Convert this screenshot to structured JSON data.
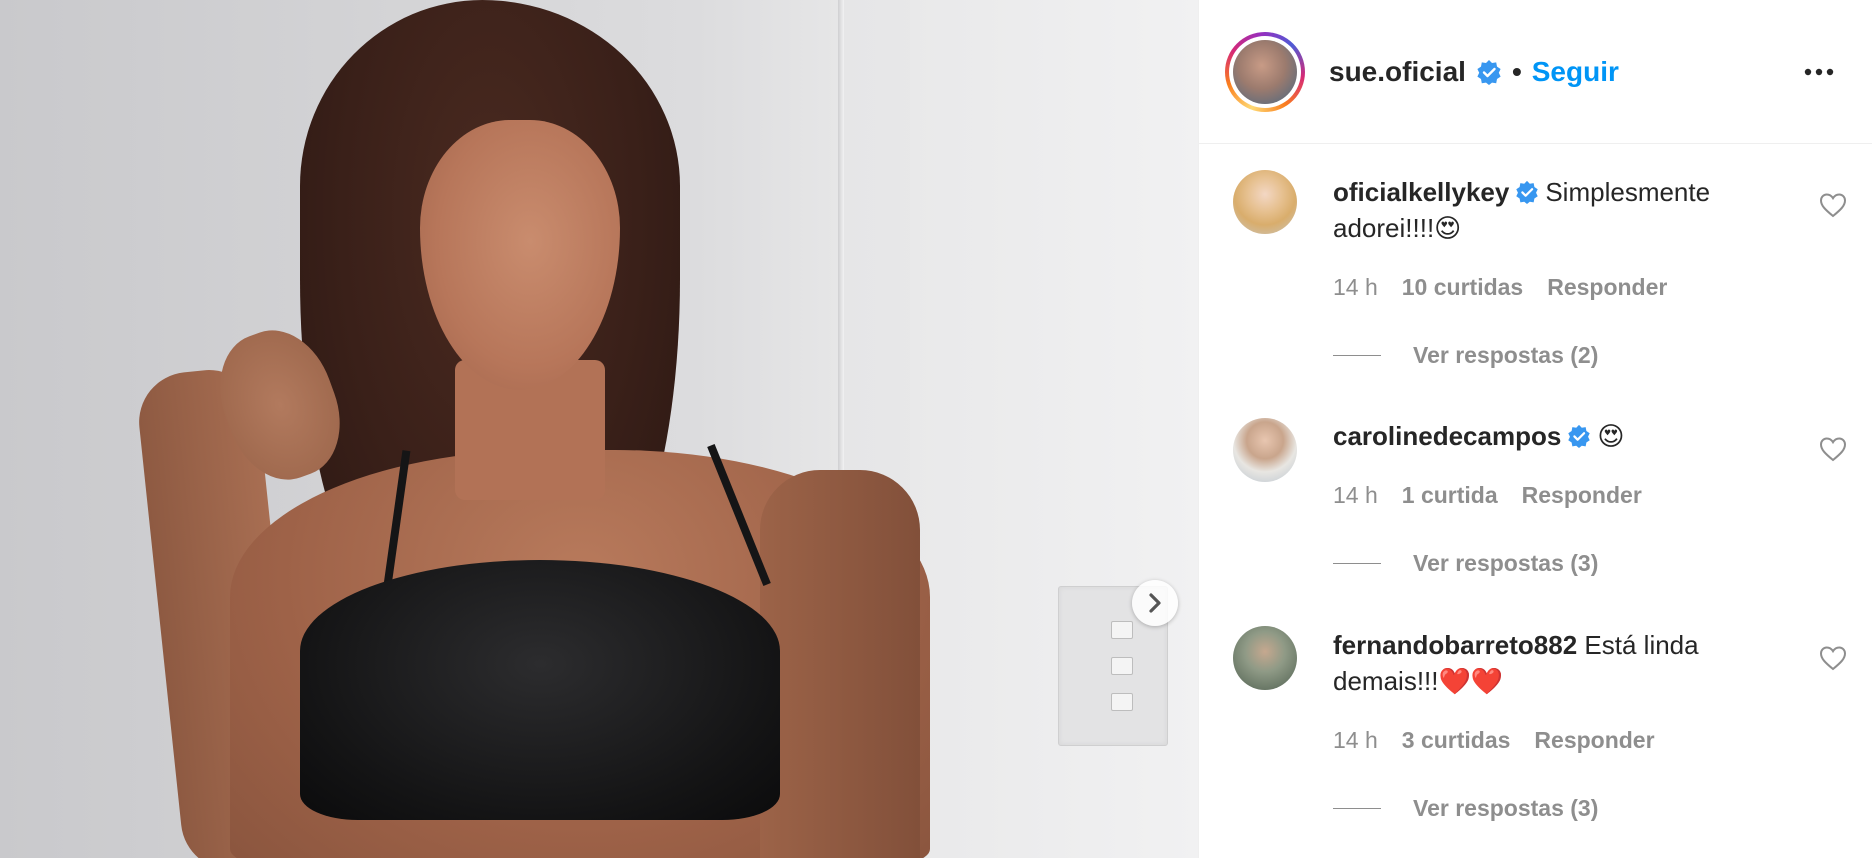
{
  "post": {
    "author": "sue.oficial",
    "separator": "•",
    "follow_label": "Seguir",
    "verified_icon": "verified-badge-icon",
    "more_icon": "more-options-icon",
    "next_icon": "chevron-right-icon"
  },
  "comments": [
    {
      "username": "oficialkellykey",
      "verified": true,
      "text": "Simplesmente adorei!!!!😍",
      "time": "14 h",
      "likes": "10 curtidas",
      "reply_label": "Responder",
      "view_replies": "Ver respostas (2)"
    },
    {
      "username": "carolinedecampos",
      "verified": true,
      "text": "😍",
      "time": "14 h",
      "likes": "1 curtida",
      "reply_label": "Responder",
      "view_replies": "Ver respostas (3)"
    },
    {
      "username": "fernandobarreto882",
      "verified": false,
      "text": "Está linda demais!!!❤️❤️",
      "time": "14 h",
      "likes": "3 curtidas",
      "reply_label": "Responder",
      "view_replies": "Ver respostas (3)"
    }
  ],
  "colors": {
    "link_blue": "#0095f6",
    "text": "#262626",
    "muted": "#8e8e8e",
    "verified_blue": "#3897f0"
  }
}
